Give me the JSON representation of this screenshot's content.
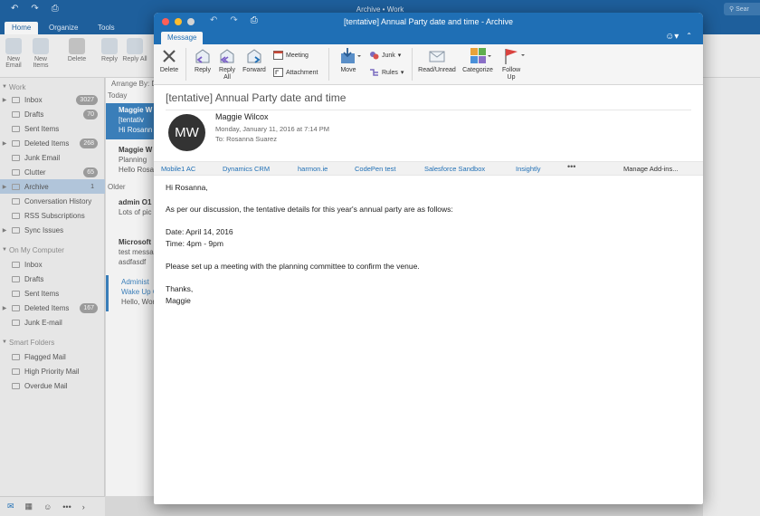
{
  "app": {
    "title": "Archive • Work",
    "search_placeholder": "Sear",
    "tabs": [
      "Home",
      "Organize",
      "Tools"
    ],
    "ribbon": [
      "New Email",
      "New Items",
      "Delete",
      "Reply",
      "Reply All"
    ]
  },
  "sidebar": {
    "groups": [
      {
        "label": "Work"
      },
      {
        "label": "On My Computer"
      },
      {
        "label": "Smart Folders"
      }
    ],
    "work_items": [
      {
        "label": "Inbox",
        "badge": "3027"
      },
      {
        "label": "Drafts",
        "badge": "70"
      },
      {
        "label": "Sent Items",
        "badge": ""
      },
      {
        "label": "Deleted Items",
        "badge": "268"
      },
      {
        "label": "Junk Email",
        "badge": ""
      },
      {
        "label": "Clutter",
        "badge": "65"
      },
      {
        "label": "Archive",
        "badge": "1"
      },
      {
        "label": "Conversation History",
        "badge": ""
      },
      {
        "label": "RSS Subscriptions",
        "badge": ""
      },
      {
        "label": "Sync Issues",
        "badge": ""
      }
    ],
    "computer_items": [
      {
        "label": "Inbox",
        "badge": ""
      },
      {
        "label": "Drafts",
        "badge": ""
      },
      {
        "label": "Sent Items",
        "badge": ""
      },
      {
        "label": "Deleted Items",
        "badge": "167"
      },
      {
        "label": "Junk E-mail",
        "badge": ""
      }
    ],
    "smart_items": [
      {
        "label": "Flagged Mail"
      },
      {
        "label": "High Priority Mail"
      },
      {
        "label": "Overdue Mail"
      }
    ]
  },
  "list": {
    "arrange": "Arrange By: D",
    "today": "Today",
    "older": "Older",
    "items": [
      {
        "from": "Maggie W",
        "line2": "[tentativ",
        "line3": "Hi Rosann"
      },
      {
        "from": "Maggie W",
        "line2": "Planning",
        "line3": "Hello Rosa"
      },
      {
        "from": "admin O1",
        "line2": "Lots of pic",
        "line3": ""
      },
      {
        "from": "Microsoft",
        "line2": "test messa",
        "line3": "asdfasdf"
      },
      {
        "from": "Administ",
        "line2": "Wake Up C",
        "line3": "Hello, Worl"
      }
    ]
  },
  "window": {
    "title": "[tentative] Annual Party date and time - Archive",
    "tab": "Message",
    "ribbon": {
      "delete": "Delete",
      "reply": "Reply",
      "reply_all": "Reply All",
      "forward": "Forward",
      "meeting": "Meeting",
      "attachment": "Attachment",
      "move": "Move",
      "junk": "Junk",
      "rules": "Rules",
      "read_unread": "Read/Unread",
      "categorize": "Categorize",
      "follow_up": "Follow Up"
    }
  },
  "message": {
    "subject": "[tentative] Annual Party date and time",
    "avatar_initials": "MW",
    "sender": "Maggie Wilcox",
    "date": "Monday, January 11, 2016 at 7:14 PM",
    "to": "To:  Rosanna Suarez",
    "body": [
      "Hi Rosanna,",
      "As per our discussion, the tentative details for this year's annual party are as follows:",
      "Date: April 14, 2016",
      "Time: 4pm - 9pm",
      "Please set up a meeting with the planning committee to confirm the venue.",
      "Thanks,",
      "Maggie"
    ]
  },
  "addins": [
    "Mobile1 AC",
    "Dynamics CRM",
    "harmon.ie",
    "CodePen test",
    "Salesforce Sandbox",
    "Insightly",
    "•••",
    "Manage Add-ins..."
  ],
  "colors": {
    "brand": "#1f6fb5",
    "avatar": "#333333"
  }
}
